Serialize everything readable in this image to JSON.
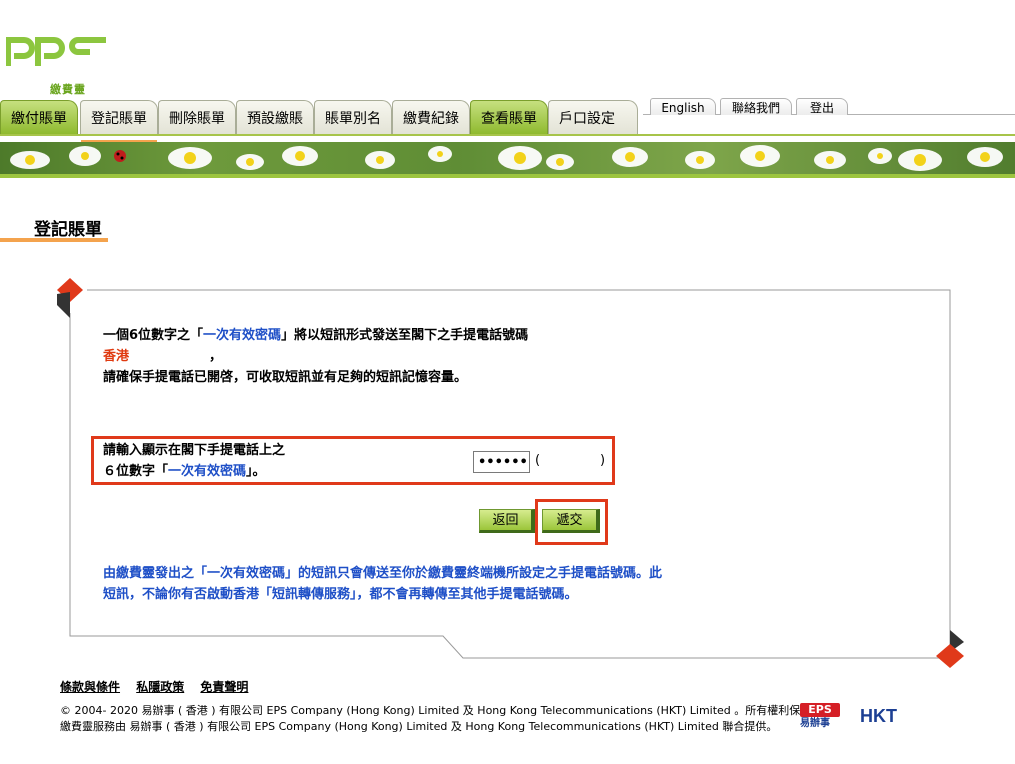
{
  "brand": {
    "logo_text": "PPS",
    "logo_sub": "繳費靈"
  },
  "nav": {
    "tabs": [
      {
        "label": "繳付賬單",
        "style": "green"
      },
      {
        "label": "登記賬單",
        "style": "normal",
        "active": true
      },
      {
        "label": "刪除賬單",
        "style": "normal"
      },
      {
        "label": "預設繳賬",
        "style": "normal"
      },
      {
        "label": "賬單別名",
        "style": "normal"
      },
      {
        "label": "繳費紀錄",
        "style": "normal"
      },
      {
        "label": "查看賬單",
        "style": "green"
      },
      {
        "label": "戶口設定",
        "style": "normal"
      }
    ],
    "utility": [
      {
        "label": "English"
      },
      {
        "label": "聯絡我們"
      },
      {
        "label": "登出"
      }
    ]
  },
  "page": {
    "title": "登記賬單"
  },
  "message": {
    "line1_prefix": "一個6位數字之「",
    "line1_otp": "一次有效密碼",
    "line1_suffix": "」將以短訊形式發送至閣下之手提電話號碼",
    "region": "香港",
    "region_suffix": "，",
    "line3": "請確保手提電話已開啓，可收取短訊並有足夠的短訊記憶容量。"
  },
  "otp_entry": {
    "label_line1": "請輸入顯示在閣下手提電話上之",
    "label_line2_prefix": "６位數字「",
    "label_line2_otp": "一次有效密碼",
    "label_line2_suffix": "」。",
    "input_value": "••••••",
    "paren_open": "(",
    "paren_close": ")"
  },
  "buttons": {
    "back": "返回",
    "submit": "遞交"
  },
  "note": {
    "line1": "由繳費靈發出之「一次有效密碼」的短訊只會傳送至你於繳費靈終端機所設定之手提電話號碼。此",
    "line2": "短訊，不論你有否啟動香港「短訊轉傳服務」，都不會再轉傳至其他手提電話號碼。"
  },
  "footer": {
    "links": [
      "條款與條件",
      "私隱政策",
      "免責聲明"
    ],
    "copyright_line1": "© 2004- 2020 易辦事 ( 香港 ) 有限公司 EPS Company (Hong Kong) Limited 及 Hong Kong Telecommunications (HKT) Limited 。所有權利保留。",
    "copyright_line2": "繳費靈服務由 易辦事 ( 香港 ) 有限公司 EPS Company (Hong Kong) Limited 及 Hong Kong Telecommunications (HKT) Limited 聯合提供。",
    "eps_logo_text": "EPS",
    "eps_logo_sub": "易辦事",
    "hkt_logo_text": "HKT"
  },
  "colors": {
    "accent_green": "#9cc53f",
    "accent_orange": "#f4a34d",
    "highlight_red": "#e0391a",
    "link_blue": "#1e4fc7"
  }
}
